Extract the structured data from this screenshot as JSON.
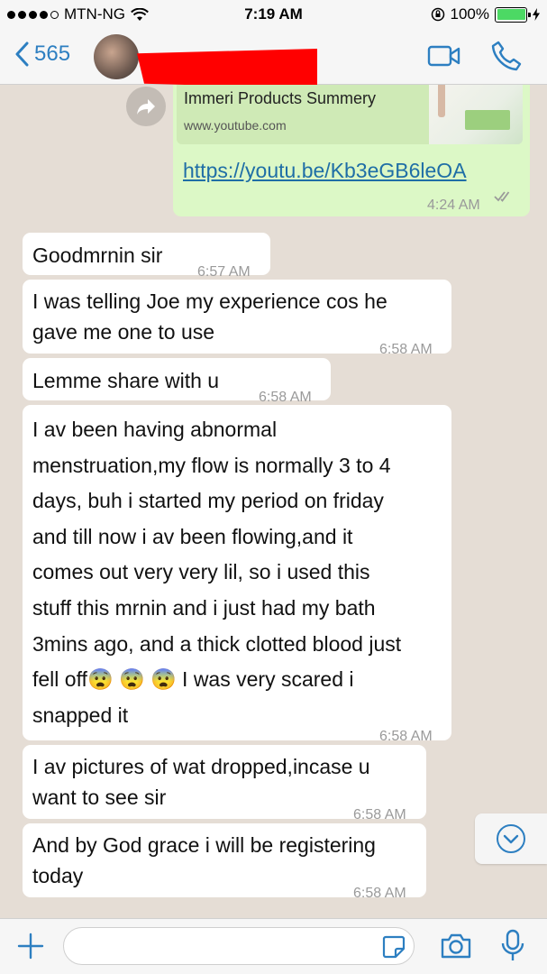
{
  "status": {
    "carrier": "MTN-NG",
    "time": "7:19 AM",
    "battery": "100%"
  },
  "nav": {
    "back_count": "565"
  },
  "messages": {
    "shared": {
      "title": "Immeri Products Summery",
      "domain": "www.youtube.com",
      "url": "https://youtu.be/Kb3eGB6leOA",
      "time": "4:24 AM"
    },
    "m1": {
      "text": "Goodmrnin sir",
      "time": "6:57 AM"
    },
    "m2": {
      "lines": [
        "I was telling Joe my experience cos he",
        "gave me one to use"
      ],
      "time": "6:58 AM"
    },
    "m3": {
      "text": "Lemme share with u",
      "time": "6:58 AM"
    },
    "m4": {
      "lines": [
        "I av been having abnormal",
        "menstruation,my flow is normally 3 to 4",
        "days, buh i started my period on friday",
        "and till now i av been flowing,and it",
        "comes out very very lil, so i used this",
        "stuff this mrnin and i just had my bath",
        "3mins ago, and a thick clotted blood just"
      ],
      "line8_start": "fell off",
      "emoji": "😨",
      "line8_end": "I was very scared i",
      "line9": "snapped it",
      "time": "6:58 AM"
    },
    "m5": {
      "lines": [
        "I av pictures of wat dropped,incase u",
        "want to see sir"
      ],
      "time": "6:58 AM"
    },
    "m6": {
      "lines": [
        "And by God grace i will be registering",
        "today"
      ],
      "time": "6:58 AM"
    }
  },
  "icons": {
    "back": "chevron-left-icon",
    "video": "video-camera-icon",
    "call": "phone-icon",
    "share": "forward-arrow-icon",
    "read": "double-check-icon",
    "scroll": "chevron-down-icon",
    "plus": "plus-icon",
    "sticker": "sticker-icon",
    "camera": "camera-icon",
    "mic": "microphone-icon"
  },
  "colors": {
    "accent": "#2d7fc1",
    "chat_bg": "#e5ddd5",
    "outgoing": "#dcf8c6",
    "incoming": "#ffffff",
    "redaction": "#ff0000"
  }
}
